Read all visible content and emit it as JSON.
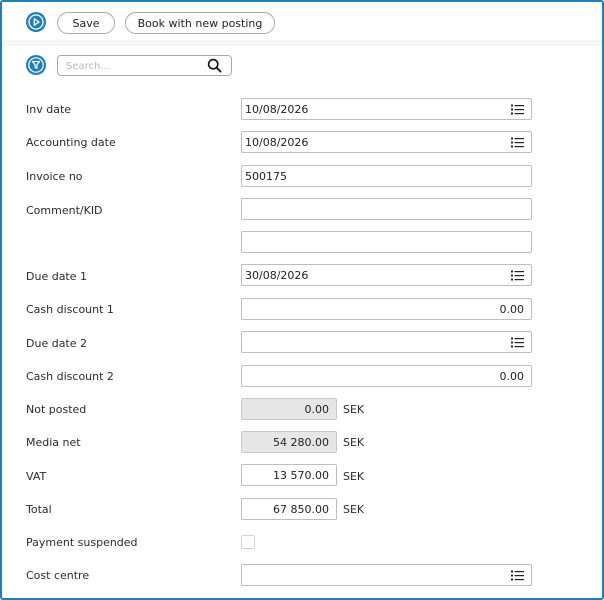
{
  "toolbar": {
    "run_icon": "play-icon",
    "save_label": "Save",
    "book_label": "Book with new posting"
  },
  "filter": {
    "filter_icon": "funnel-icon",
    "search_placeholder": "Search...",
    "search_value": "",
    "search_icon": "magnifier-icon"
  },
  "form": {
    "inv_date": {
      "label": "Inv date",
      "value": "10/08/2026"
    },
    "accounting_date": {
      "label": "Accounting date",
      "value": "10/08/2026"
    },
    "invoice_no": {
      "label": "Invoice no",
      "value": "500175"
    },
    "comment_kid": {
      "label": "Comment/KID",
      "value": "",
      "value2": ""
    },
    "due_date_1": {
      "label": "Due date 1",
      "value": "30/08/2026"
    },
    "cash_discount_1": {
      "label": "Cash discount 1",
      "value": "0.00"
    },
    "due_date_2": {
      "label": "Due date 2",
      "value": ""
    },
    "cash_discount_2": {
      "label": "Cash discount 2",
      "value": "0.00"
    },
    "not_posted": {
      "label": "Not posted",
      "value": "0.00",
      "unit": "SEK"
    },
    "media_net": {
      "label": "Media net",
      "value": "54 280.00",
      "unit": "SEK"
    },
    "vat": {
      "label": "VAT",
      "value": "13 570.00",
      "unit": "SEK"
    },
    "total": {
      "label": "Total",
      "value": "67 850.00",
      "unit": "SEK"
    },
    "payment_suspended": {
      "label": "Payment suspended",
      "checked": false
    },
    "cost_centre": {
      "label": "Cost centre",
      "value": ""
    }
  },
  "colors": {
    "accent": "#1f7fb8",
    "disabled_field": "#e6e6e6",
    "border": "#bdbdbd"
  }
}
